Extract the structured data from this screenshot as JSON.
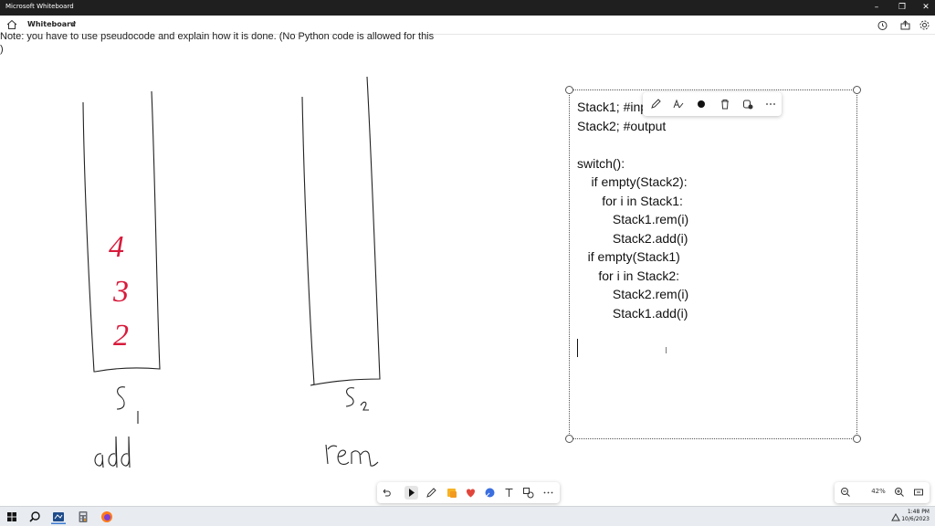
{
  "window": {
    "title": "Microsoft Whiteboard",
    "minimize": "–",
    "restore": "❐",
    "close": "✕"
  },
  "header": {
    "app_name": "Whiteboard",
    "icons": [
      "home-icon",
      "chevron-down-icon",
      "timer-icon",
      "share-icon",
      "settings-icon"
    ]
  },
  "canvas": {
    "note_line": "Note: you have to use pseudocode and explain how it is done.  (No Python code is allowed for this",
    "note_line2": ")",
    "ink": {
      "stack1_items": [
        "4",
        "3",
        "2"
      ],
      "stack1_label": "S1",
      "stack1_op": "add",
      "stack2_label": "S2",
      "stack2_op": "rem",
      "ink_color_items": "#d81b3c",
      "ink_color_outline": "#222222"
    },
    "textbox": {
      "lines": [
        "Stack1; #input",
        "Stack2; #output",
        "",
        "switch():",
        "    if empty(Stack2):",
        "       for i in Stack1:",
        "          Stack1.rem(i)",
        "          Stack2.add(i)",
        "   if empty(Stack1)",
        "      for i in Stack2:",
        "          Stack2.rem(i)",
        "          Stack1.add(i)"
      ]
    }
  },
  "context_toolbar": {
    "tools": [
      "pen-edit-icon",
      "text-style-icon",
      "color-dot-icon",
      "delete-icon",
      "copy-icon",
      "more-icon"
    ]
  },
  "bottom_toolbar": {
    "tools": [
      "undo-icon",
      "select-icon",
      "pen-icon",
      "sticky-note-icon",
      "reaction-icon",
      "shapes-icon",
      "text-icon",
      "more-shapes-icon",
      "more-icon"
    ]
  },
  "zoom": {
    "level": "42%"
  },
  "taskbar": {
    "time": "1:48 PM",
    "date": "10/6/2023"
  }
}
